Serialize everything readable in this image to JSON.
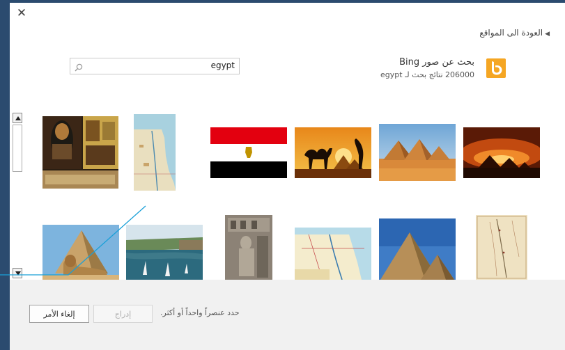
{
  "dialog": {
    "close_glyph": "✕",
    "back_link": "العودة الى المواقع"
  },
  "source": {
    "icon": "bing-logo",
    "title": "بحث عن صور Bing",
    "subtitle": "206000 نتائج بحث لـ egypt"
  },
  "search": {
    "value": "egypt",
    "placeholder": ""
  },
  "images": [
    {
      "name": "image-egyptian-artifacts",
      "alt": "Egyptian artifacts"
    },
    {
      "name": "image-egypt-map",
      "alt": "Map of Egypt"
    },
    {
      "name": "image-egypt-flag",
      "alt": "Flag of Egypt"
    },
    {
      "name": "image-camel-sunset",
      "alt": "Camel at sunset with pyramids"
    },
    {
      "name": "image-pyramids-desert",
      "alt": "Pyramids in desert"
    },
    {
      "name": "image-pyramids-sunset",
      "alt": "Pyramids silhouette at sunset"
    },
    {
      "name": "image-sphinx",
      "alt": "Sphinx and pyramid"
    },
    {
      "name": "image-nile-aswan",
      "alt": "Nile river with feluccas"
    },
    {
      "name": "image-temple-relief",
      "alt": "Temple relief carving"
    },
    {
      "name": "image-egypt-road-map",
      "alt": "Road map of Egypt"
    },
    {
      "name": "image-pyramids-giza",
      "alt": "Pyramids of Giza"
    },
    {
      "name": "image-old-map-egypt",
      "alt": "Old map of Egypt"
    }
  ],
  "footer": {
    "cancel_label": "إلغاء الأمر",
    "insert_label": "إدراج",
    "status": "حدد عنصراً واحداً أو أكثر."
  },
  "colors": {
    "bing_orange": "#f5a623",
    "frame": "#2b4b6f",
    "footer_bg": "#f1f1f1",
    "annotation_line": "#1aa0d8"
  }
}
